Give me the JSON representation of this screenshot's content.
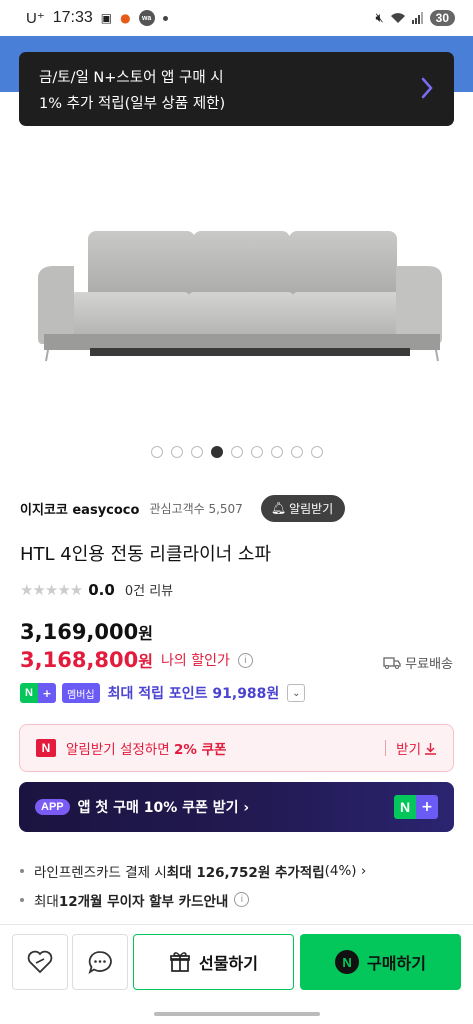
{
  "status_bar": {
    "carrier": "U⁺",
    "time": "17:33",
    "battery": "30"
  },
  "toast": {
    "line1": "금/토/일 N+스토어 앱 구매 시",
    "line2": "1% 추가 적립(일부 상품 제한)"
  },
  "gallery": {
    "total": 9,
    "active_index": 3
  },
  "store": {
    "name": "이지코코 easycoco",
    "fans": "관심고객수 5,507",
    "alarm_label": "알림받기"
  },
  "product": {
    "title": "HTL 4인용 전동 리클라이너 소파",
    "rating": "0.0",
    "review_count": "0건 리뷰",
    "original_price": "3,169,000",
    "sale_price": "3,168,800",
    "currency": "원",
    "my_discount_label": "나의 할인가",
    "shipping": "무료배송"
  },
  "points": {
    "membership_label": "멤버십",
    "text": "최대 적립 포인트 91,988원"
  },
  "coupon": {
    "text_prefix": "알림받기 설정하면 ",
    "text_bold": "2% 쿠폰",
    "get_label": "받기"
  },
  "app_banner": {
    "badge": "APP",
    "text": "앱 첫 구매 10% 쿠폰 받기 ›"
  },
  "benefits": [
    {
      "prefix": "라인프렌즈카드 결제 시 ",
      "bold": "최대 126,752원 추가적립",
      "suffix": " (4%) ›"
    },
    {
      "prefix": "최대 ",
      "bold": "12개월 무이자 할부 카드안내",
      "suffix": ""
    }
  ],
  "bottom": {
    "gift_label": "선물하기",
    "buy_label": "구매하기"
  },
  "colors": {
    "naver_green": "#03c75a",
    "sale_red": "#e31c3d",
    "membership_purple": "#6b5bf5"
  }
}
